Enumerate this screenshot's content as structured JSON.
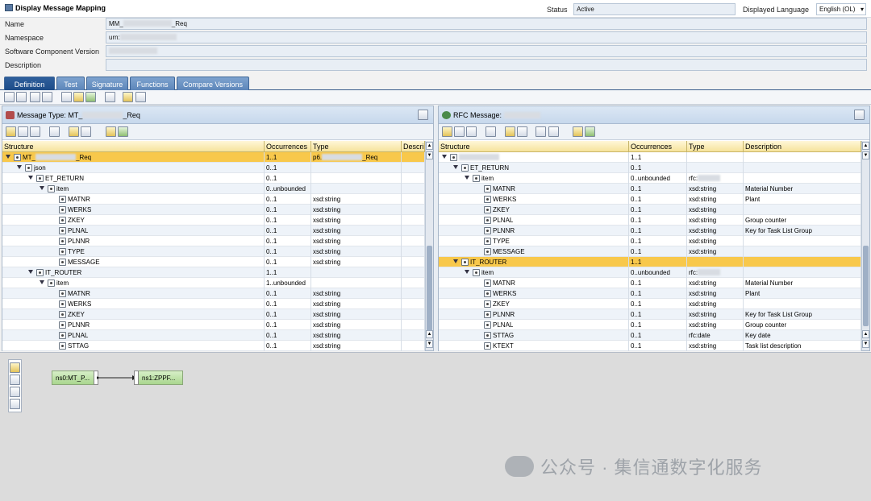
{
  "title": "Display Message Mapping",
  "header": {
    "status_label": "Status",
    "status_value": "Active",
    "lang_label": "Displayed Language",
    "lang_value": "English (OL)",
    "name_label": "Name",
    "name_prefix": "MM_",
    "name_suffix": "_Req",
    "ns_label": "Namespace",
    "ns_value": "urn:",
    "swcv_label": "Software Component Version",
    "desc_label": "Description"
  },
  "tabs": [
    "Definition",
    "Test",
    "Signature",
    "Functions",
    "Compare Versions"
  ],
  "left": {
    "title_prefix": "Message Type: MT_",
    "title_suffix": "_Req",
    "cols": [
      "Structure",
      "Occurrences",
      "Type",
      "Descri"
    ],
    "rows": [
      {
        "n": "MT_",
        "s": "_Req",
        "o": "1..1",
        "t": "p6.",
        "ts": "_Req",
        "lvl": 0,
        "tw": true,
        "sel": true
      },
      {
        "n": "json",
        "o": "0..1",
        "t": "",
        "lvl": 1,
        "tw": true
      },
      {
        "n": "ET_RETURN",
        "o": "0..1",
        "t": "",
        "lvl": 2,
        "tw": true
      },
      {
        "n": "item",
        "o": "0..unbounded",
        "t": "",
        "lvl": 3,
        "tw": true
      },
      {
        "n": "MATNR",
        "o": "0..1",
        "t": "xsd:string",
        "lvl": 4
      },
      {
        "n": "WERKS",
        "o": "0..1",
        "t": "xsd:string",
        "lvl": 4
      },
      {
        "n": "ZKEY",
        "o": "0..1",
        "t": "xsd:string",
        "lvl": 4
      },
      {
        "n": "PLNAL",
        "o": "0..1",
        "t": "xsd:string",
        "lvl": 4
      },
      {
        "n": "PLNNR",
        "o": "0..1",
        "t": "xsd:string",
        "lvl": 4
      },
      {
        "n": "TYPE",
        "o": "0..1",
        "t": "xsd:string",
        "lvl": 4
      },
      {
        "n": "MESSAGE",
        "o": "0..1",
        "t": "xsd:string",
        "lvl": 4
      },
      {
        "n": "IT_ROUTER",
        "o": "1..1",
        "t": "",
        "lvl": 2,
        "tw": true
      },
      {
        "n": "item",
        "o": "1..unbounded",
        "t": "",
        "lvl": 3,
        "tw": true
      },
      {
        "n": "MATNR",
        "o": "0..1",
        "t": "xsd:string",
        "lvl": 4
      },
      {
        "n": "WERKS",
        "o": "0..1",
        "t": "xsd:string",
        "lvl": 4
      },
      {
        "n": "ZKEY",
        "o": "0..1",
        "t": "xsd:string",
        "lvl": 4
      },
      {
        "n": "PLNNR",
        "o": "0..1",
        "t": "xsd:string",
        "lvl": 4
      },
      {
        "n": "PLNAL",
        "o": "0..1",
        "t": "xsd:string",
        "lvl": 4
      },
      {
        "n": "STTAG",
        "o": "0..1",
        "t": "xsd:string",
        "lvl": 4
      }
    ]
  },
  "right": {
    "title_prefix": "RFC Message:",
    "cols": [
      "Structure",
      "Occurrences",
      "Type",
      "Description"
    ],
    "rows": [
      {
        "n": "",
        "o": "1..1",
        "t": "",
        "d": "",
        "lvl": 0,
        "tw": true
      },
      {
        "n": "ET_RETURN",
        "o": "0..1",
        "t": "",
        "d": "",
        "lvl": 1,
        "tw": true
      },
      {
        "n": "item",
        "o": "0..unbounded",
        "t": "rfc:",
        "d": "",
        "lvl": 2,
        "tw": true
      },
      {
        "n": "MATNR",
        "o": "0..1",
        "t": "xsd:string",
        "d": "Material Number",
        "lvl": 3
      },
      {
        "n": "WERKS",
        "o": "0..1",
        "t": "xsd:string",
        "d": "Plant",
        "lvl": 3
      },
      {
        "n": "ZKEY",
        "o": "0..1",
        "t": "xsd:string",
        "d": "",
        "lvl": 3
      },
      {
        "n": "PLNAL",
        "o": "0..1",
        "t": "xsd:string",
        "d": "Group counter",
        "lvl": 3
      },
      {
        "n": "PLNNR",
        "o": "0..1",
        "t": "xsd:string",
        "d": "Key for Task List Group",
        "lvl": 3
      },
      {
        "n": "TYPE",
        "o": "0..1",
        "t": "xsd:string",
        "d": "",
        "lvl": 3
      },
      {
        "n": "MESSAGE",
        "o": "0..1",
        "t": "xsd:string",
        "d": "",
        "lvl": 3
      },
      {
        "n": "IT_ROUTER",
        "o": "1..1",
        "t": "",
        "d": "",
        "lvl": 1,
        "tw": true,
        "sel": true
      },
      {
        "n": "item",
        "o": "0..unbounded",
        "t": "rfc:",
        "d": "",
        "lvl": 2,
        "tw": true
      },
      {
        "n": "MATNR",
        "o": "0..1",
        "t": "xsd:string",
        "d": "Material Number",
        "lvl": 3
      },
      {
        "n": "WERKS",
        "o": "0..1",
        "t": "xsd:string",
        "d": "Plant",
        "lvl": 3
      },
      {
        "n": "ZKEY",
        "o": "0..1",
        "t": "xsd:string",
        "d": "",
        "lvl": 3
      },
      {
        "n": "PLNNR",
        "o": "0..1",
        "t": "xsd:string",
        "d": "Key for Task List Group",
        "lvl": 3
      },
      {
        "n": "PLNAL",
        "o": "0..1",
        "t": "xsd:string",
        "d": "Group counter",
        "lvl": 3
      },
      {
        "n": "STTAG",
        "o": "0..1",
        "t": "rfc:date",
        "d": "Key date",
        "lvl": 3
      },
      {
        "n": "KTEXT",
        "o": "0..1",
        "t": "xsd:string",
        "d": "Task list description",
        "lvl": 3
      }
    ]
  },
  "mapping": {
    "source": "ns0:MT_P...",
    "target": "ns1:ZPPF..."
  },
  "watermark": "公众号 · 集信通数字化服务",
  "colors": {
    "selected": "#f8c84b",
    "tab_active": "#1d4c88",
    "header_bg": "#f6e39b"
  }
}
